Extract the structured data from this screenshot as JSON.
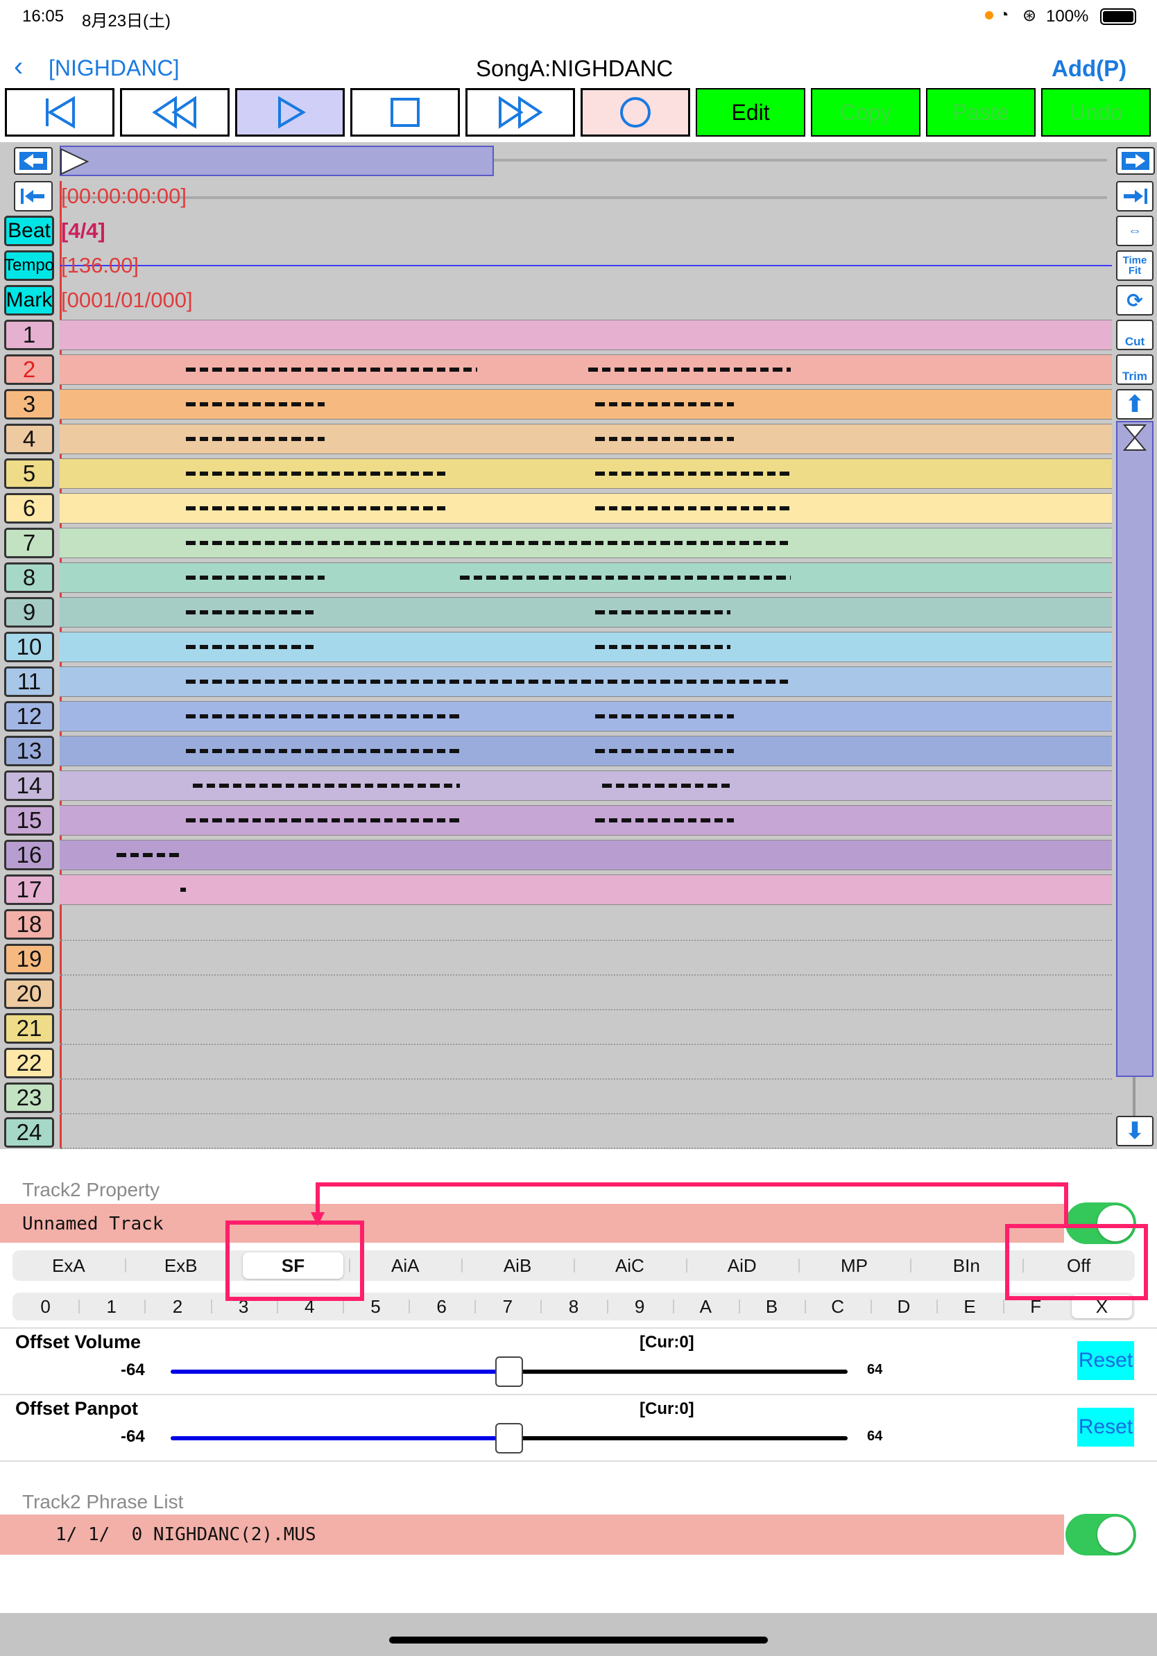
{
  "status": {
    "time": "16:05",
    "date": "8月23日(土)",
    "battery": "100%"
  },
  "nav": {
    "back_label": "[NIGHDANC]",
    "title": "SongA:NIGHDANC",
    "add_label": "Add(P)"
  },
  "toolbar": {
    "edit": "Edit",
    "copy": "Copy",
    "paste": "Paste",
    "undo": "Undo"
  },
  "timeline": {
    "time": "[00:00:00:00]",
    "beat_label": "Beat",
    "beat_value": "[4/4]",
    "tempo_label": "Tempo",
    "tempo_value": "[136.00]",
    "mark_label": "Mark",
    "mark_value": "[0001/01/000]"
  },
  "tracks": [
    {
      "n": "1",
      "color": "#e6b0d0"
    },
    {
      "n": "2",
      "color": "#f2b0a8"
    },
    {
      "n": "3",
      "color": "#f6ba80"
    },
    {
      "n": "4",
      "color": "#eecaa0"
    },
    {
      "n": "5",
      "color": "#eedc88"
    },
    {
      "n": "6",
      "color": "#fde8a8"
    },
    {
      "n": "7",
      "color": "#c2e2c2"
    },
    {
      "n": "8",
      "color": "#a6d8c8"
    },
    {
      "n": "9",
      "color": "#a6ccc6"
    },
    {
      "n": "10",
      "color": "#a6d8ec"
    },
    {
      "n": "11",
      "color": "#a8c6e8"
    },
    {
      "n": "12",
      "color": "#a2b6e6"
    },
    {
      "n": "13",
      "color": "#9aacdc"
    },
    {
      "n": "14",
      "color": "#c6b8dc"
    },
    {
      "n": "15",
      "color": "#c6a6d4"
    },
    {
      "n": "16",
      "color": "#b89ed0"
    },
    {
      "n": "17",
      "color": "#e6b0d0"
    },
    {
      "n": "18",
      "color": "#f2b0a8"
    },
    {
      "n": "19",
      "color": "#f6ba80"
    },
    {
      "n": "20",
      "color": "#eecaa0"
    },
    {
      "n": "21",
      "color": "#eedc88"
    },
    {
      "n": "22",
      "color": "#fde8a8"
    },
    {
      "n": "23",
      "color": "#c2e2c2"
    },
    {
      "n": "24",
      "color": "#a6d8c8"
    }
  ],
  "right_tools": {
    "time_fit": "Time Fit",
    "cut": "Cut",
    "trim": "Trim"
  },
  "property": {
    "section_title": "Track2 Property",
    "track_name": "Unnamed Track",
    "toggle_on": true
  },
  "modes": {
    "items": [
      "ExA",
      "ExB",
      "SF",
      "AiA",
      "AiB",
      "AiC",
      "AiD",
      "MP",
      "BIn",
      "Off"
    ],
    "selected": "SF"
  },
  "channels": {
    "items": [
      "0",
      "1",
      "2",
      "3",
      "4",
      "5",
      "6",
      "7",
      "8",
      "9",
      "A",
      "B",
      "C",
      "D",
      "E",
      "F",
      "X"
    ],
    "selected": "X"
  },
  "offset_volume": {
    "label": "Offset Volume",
    "cur": "[Cur:0]",
    "min": "-64",
    "max": "64",
    "reset": "Reset",
    "value": 0
  },
  "offset_panpot": {
    "label": "Offset Panpot",
    "cur": "[Cur:0]",
    "min": "-64",
    "max": "64",
    "reset": "Reset",
    "value": 0
  },
  "phrase": {
    "section_title": "Track2 Phrase List",
    "row": "1/ 1/  0 NIGHDANC(2).MUS",
    "toggle_on": true
  },
  "colors": {
    "accent": "#1a7ae0",
    "highlight": "#ff1f6b",
    "selected_track_bg": "#f2b0a8"
  }
}
